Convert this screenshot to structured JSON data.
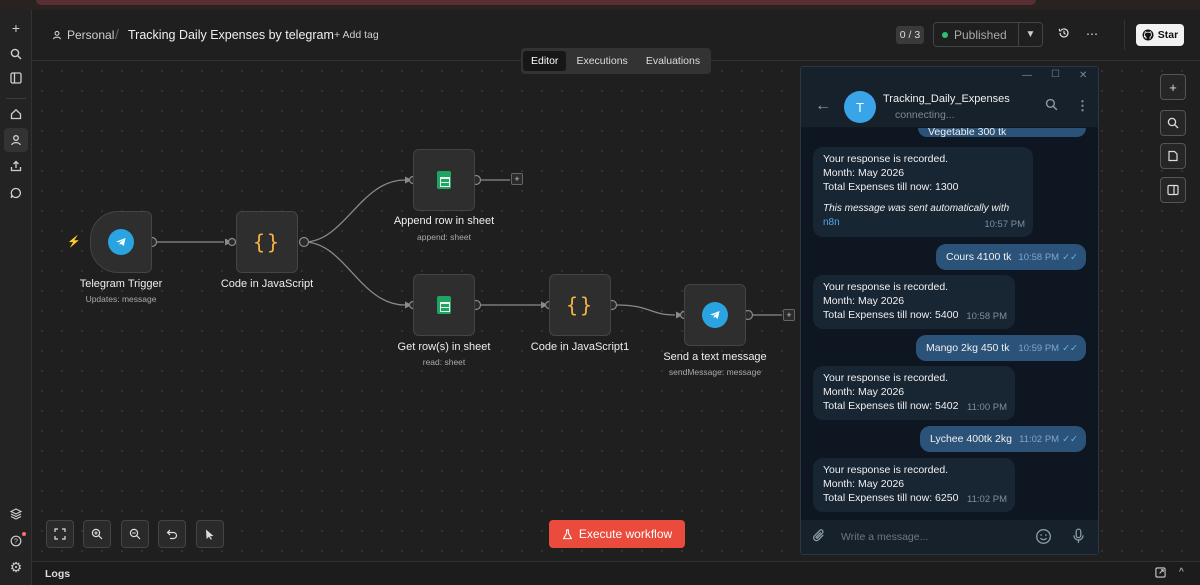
{
  "header": {
    "project_label": "Personal",
    "workflow_title": "Tracking Daily Expenses by telegram",
    "add_tag_label": "+ Add tag",
    "counter": "0 / 3",
    "status_label": "Published",
    "star_label": "Star",
    "status_color": "#2fbf71"
  },
  "tabs": [
    "Editor",
    "Executions",
    "Evaluations"
  ],
  "nodes": {
    "trigger": {
      "label": "Telegram Trigger",
      "sub": "Updates: message"
    },
    "code1": {
      "label": "Code in JavaScript"
    },
    "append": {
      "label": "Append row in sheet",
      "sub": "append: sheet"
    },
    "getrows": {
      "label": "Get row(s) in sheet",
      "sub": "read: sheet"
    },
    "code2": {
      "label": "Code in JavaScript1"
    },
    "send": {
      "label": "Send a text message",
      "sub": "sendMessage: message"
    }
  },
  "execute_label": "Execute workflow",
  "logs_label": "Logs",
  "telegram": {
    "chat_name": "Tracking_Daily_Expenses",
    "status": "connecting...",
    "avatar_letter": "T",
    "input_placeholder": "Write a message...",
    "messages": [
      {
        "dir": "out",
        "text": "Vegetable 300 tk",
        "time": "10:57 PM"
      },
      {
        "dir": "in",
        "lines": [
          "Your response is recorded.",
          "Month: May 2026",
          "Total Expenses till now: 1300"
        ],
        "note": "This message was sent automatically with",
        "note_link": "n8n",
        "time": "10:57 PM"
      },
      {
        "dir": "out",
        "text": "Cours 4100 tk",
        "time": "10:58 PM"
      },
      {
        "dir": "in",
        "lines": [
          "Your response is recorded.",
          "Month: May 2026",
          "Total Expenses till now: 5400"
        ],
        "time": "10:58 PM"
      },
      {
        "dir": "out",
        "text": "Mango 2kg 450 tk",
        "time": "10:59 PM"
      },
      {
        "dir": "in",
        "lines": [
          "Your response is recorded.",
          "Month: May 2026",
          "Total Expenses till now: 5402"
        ],
        "time": "11:00 PM"
      },
      {
        "dir": "out",
        "text": "Lychee 400tk 2kg",
        "time": "11:02 PM"
      },
      {
        "dir": "in",
        "lines": [
          "Your response is recorded.",
          "Month: May 2026",
          "Total Expenses till now: 6250"
        ],
        "time": "11:02 PM"
      }
    ]
  },
  "colors": {
    "accent": "#ea4b3c",
    "telegram_blue": "#2aa4e0",
    "sheets_green": "#1fa463",
    "code_orange": "#f2b241"
  }
}
